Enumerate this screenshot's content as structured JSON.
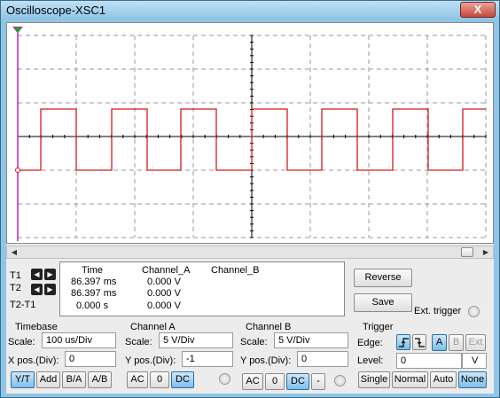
{
  "window": {
    "title": "Oscilloscope-XSC1",
    "close_label": "X"
  },
  "cursors": {
    "t1": "T1",
    "t2": "T2",
    "t2t1": "T2-T1"
  },
  "readout": {
    "headers": [
      "Time",
      "Channel_A",
      "Channel_B"
    ],
    "rows": [
      {
        "time": "86.397 ms",
        "channel_a": "0.000 V",
        "channel_b": ""
      },
      {
        "time": "86.397 ms",
        "channel_a": "0.000 V",
        "channel_b": ""
      },
      {
        "time": "0.000 s",
        "channel_a": "0.000 V",
        "channel_b": ""
      }
    ]
  },
  "actions": {
    "reverse": "Reverse",
    "save": "Save",
    "ext_trigger": "Ext. trigger"
  },
  "timebase": {
    "title": "Timebase",
    "scale_label": "Scale:",
    "scale_value": "100 us/Div",
    "xpos_label": "X pos.(Div):",
    "xpos_value": "0",
    "modes": [
      "Y/T",
      "Add",
      "B/A",
      "A/B"
    ]
  },
  "channel_a": {
    "title": "Channel A",
    "scale_label": "Scale:",
    "scale_value": "5  V/Div",
    "ypos_label": "Y pos.(Div):",
    "ypos_value": "-1",
    "coupling": [
      "AC",
      "0",
      "DC"
    ]
  },
  "channel_b": {
    "title": "Channel B",
    "scale_label": "Scale:",
    "scale_value": "5  V/Div",
    "ypos_label": "Y pos.(Div):",
    "ypos_value": "0",
    "coupling": [
      "AC",
      "0",
      "DC",
      "-"
    ]
  },
  "trigger": {
    "title": "Trigger",
    "edge_label": "Edge:",
    "sources": [
      "A",
      "B",
      "Ext"
    ],
    "level_label": "Level:",
    "level_value": "0",
    "level_unit": "V",
    "modes": [
      "Single",
      "Normal",
      "Auto",
      "None"
    ]
  },
  "colors": {
    "trace_a": "#d41a1a",
    "cursor_t1": "#c020c0",
    "grid": "#9a9a9a",
    "selected": "#7fbde9"
  },
  "icons": {
    "cursor_left": "arrow-left-icon",
    "cursor_right": "arrow-right-icon",
    "edge_rising": "rising-edge-icon",
    "edge_falling": "falling-edge-icon"
  }
}
